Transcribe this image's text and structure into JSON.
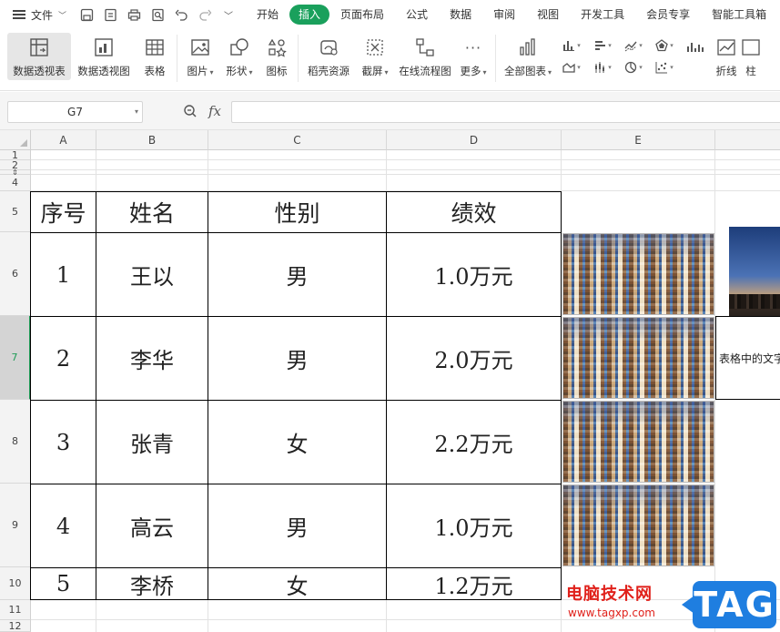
{
  "menubar": {
    "file_label": "文件",
    "tabs": [
      {
        "label": "开始",
        "active": false
      },
      {
        "label": "插入",
        "active": true
      },
      {
        "label": "页面布局",
        "active": false
      },
      {
        "label": "公式",
        "active": false
      },
      {
        "label": "数据",
        "active": false
      },
      {
        "label": "审阅",
        "active": false
      },
      {
        "label": "视图",
        "active": false
      },
      {
        "label": "开发工具",
        "active": false
      },
      {
        "label": "会员专享",
        "active": false
      },
      {
        "label": "智能工具箱",
        "active": false
      }
    ],
    "accent_color": "#1aa05c"
  },
  "ribbon": {
    "pivot_table": "数据透视表",
    "pivot_chart": "数据透视图",
    "table": "表格",
    "picture": "图片",
    "shape": "形状",
    "icon": "图标",
    "docer": "稻壳资源",
    "screenshot": "截屏",
    "flowchart": "在线流程图",
    "more": "更多",
    "all_charts": "全部图表",
    "line": "折线",
    "next_partial": "柱"
  },
  "formula_bar": {
    "name_box": "G7",
    "fx_label": "fx",
    "content": ""
  },
  "sheet": {
    "columns": [
      "A",
      "B",
      "C",
      "D",
      "E"
    ],
    "rows": [
      "1",
      "2",
      "3",
      "4",
      "5",
      "6",
      "7",
      "8",
      "9",
      "10",
      "11",
      "12"
    ],
    "selected_row": "7",
    "table_headers": [
      "序号",
      "姓名",
      "性别",
      "绩效"
    ],
    "table_rows": [
      [
        "1",
        "王以",
        "男",
        "1.0万元"
      ],
      [
        "2",
        "李华",
        "男",
        "2.0万元"
      ],
      [
        "3",
        "张青",
        "女",
        "2.2万元"
      ],
      [
        "4",
        "高云",
        "男",
        "1.0万元"
      ],
      [
        "5",
        "李桥",
        "女",
        "1.2万元"
      ]
    ],
    "overflow_text": "表格中的文字"
  },
  "watermark": {
    "site_name": "电脑技术网",
    "url": "www.tagxp.com",
    "badge": "TAG"
  }
}
